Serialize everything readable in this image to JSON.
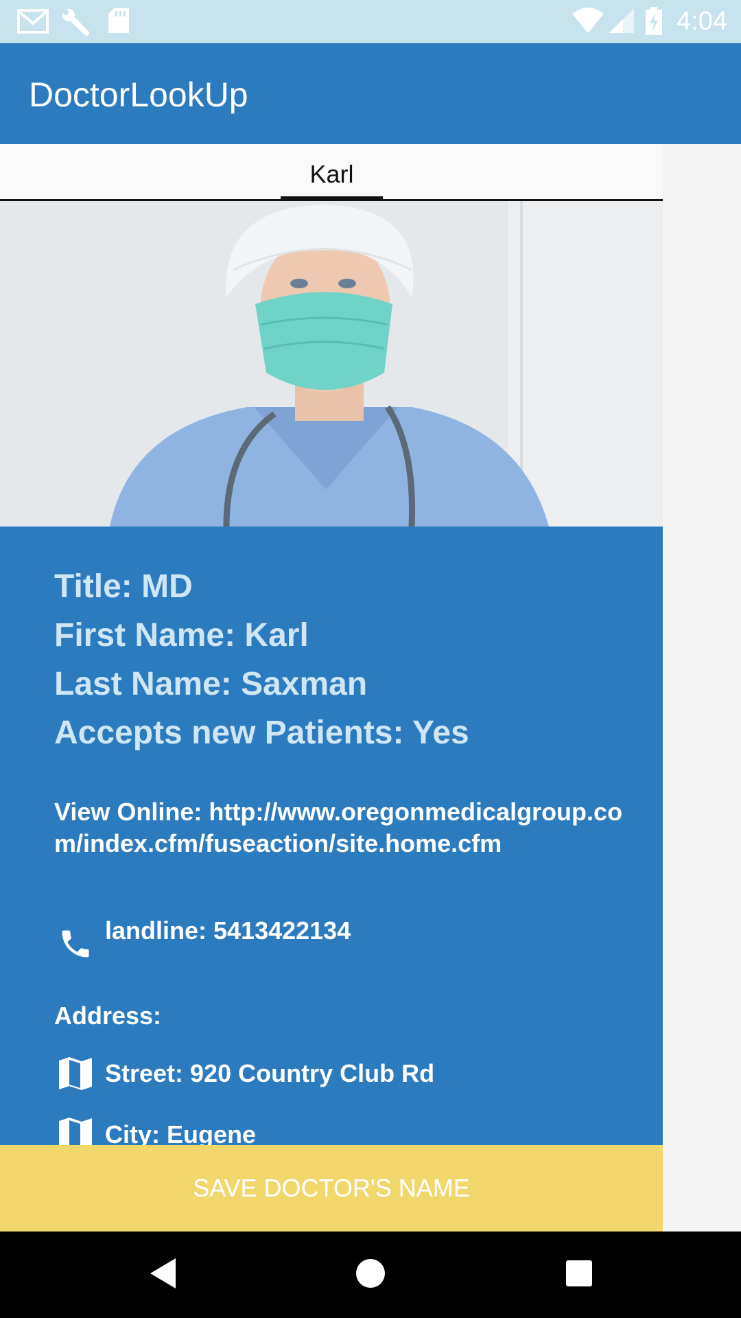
{
  "status_bar": {
    "time": "4:04",
    "icons": [
      "gmail-icon",
      "wrench-icon",
      "sd-card-icon",
      "wifi-icon",
      "signal-icon",
      "battery-charging-icon"
    ]
  },
  "app_bar": {
    "title": "DoctorLookUp"
  },
  "tabs": [
    {
      "label": "Karl",
      "selected": true
    }
  ],
  "doctor": {
    "photo": "doctor-photo",
    "title": "Title: MD",
    "first_name": "First Name: Karl",
    "last_name": "Last Name: Saxman",
    "accepts_patients": "Accepts new Patients: Yes",
    "website": "View Online: http://www.oregonmedicalgroup.com/index.cfm/fuseaction/site.home.cfm",
    "phone": "landline: 5413422134",
    "address_label": "Address:",
    "street": "Street: 920 Country Club Rd",
    "city": "City: Eugene"
  },
  "save_button": {
    "label": "SAVE DOCTOR'S NAME"
  },
  "nav_bar": {
    "icons": [
      "back-icon",
      "home-icon",
      "recents-icon"
    ]
  },
  "colors": {
    "app_bar": "#2d7bbf",
    "status_bar": "#c6e3ee",
    "details_bg": "#2d7bbf",
    "info_text": "#cfe6f5",
    "save_button": "#f2d86c"
  }
}
